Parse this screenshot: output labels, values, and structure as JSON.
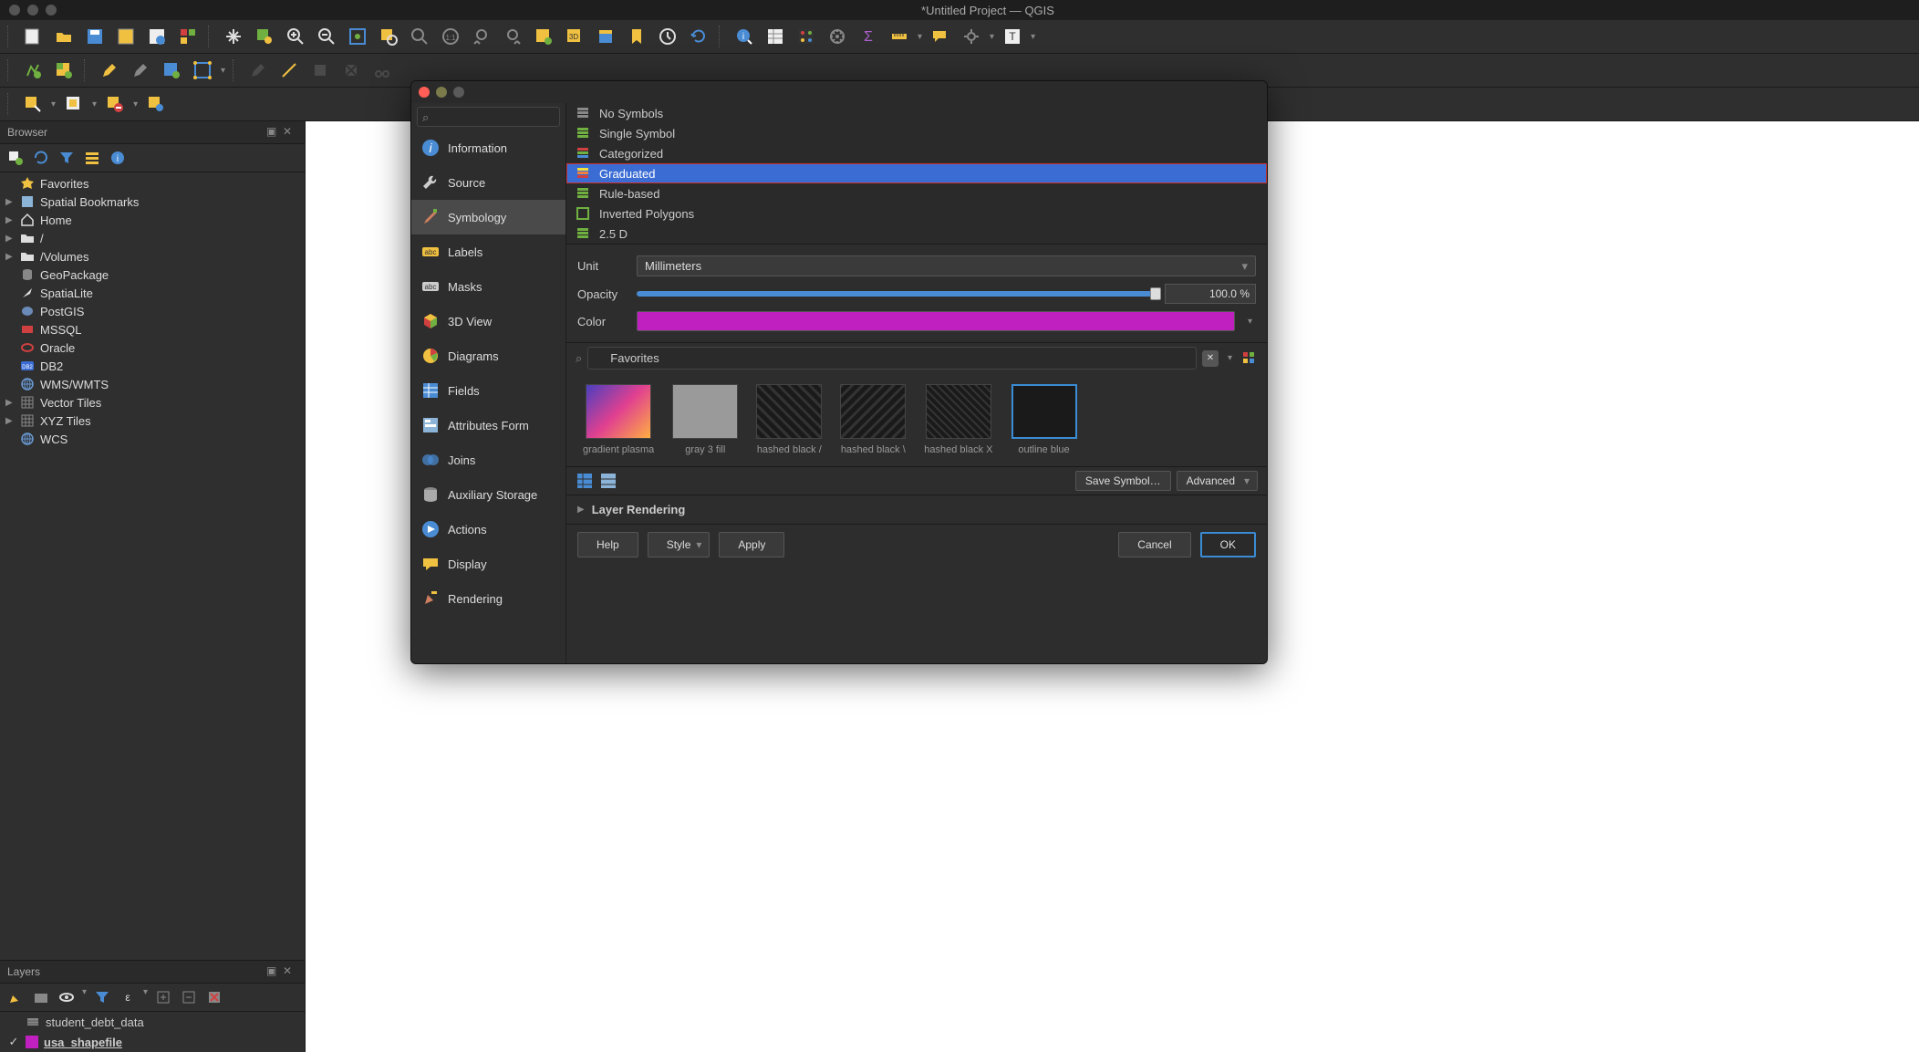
{
  "window": {
    "title": "*Untitled Project — QGIS"
  },
  "browser": {
    "title": "Browser",
    "items": [
      {
        "label": "Favorites",
        "icon": "star",
        "color": "#f0c040",
        "arrow": false
      },
      {
        "label": "Spatial Bookmarks",
        "icon": "bookmark",
        "color": "#8cb4d8",
        "arrow": true
      },
      {
        "label": "Home",
        "icon": "home",
        "color": "#ddd",
        "arrow": true
      },
      {
        "label": "/",
        "icon": "folder",
        "color": "#ddd",
        "arrow": true
      },
      {
        "label": "/Volumes",
        "icon": "folder",
        "color": "#ddd",
        "arrow": true
      },
      {
        "label": "GeoPackage",
        "icon": "db",
        "color": "#888",
        "arrow": false
      },
      {
        "label": "SpatiaLite",
        "icon": "feather",
        "color": "#ddd",
        "arrow": false
      },
      {
        "label": "PostGIS",
        "icon": "elephant",
        "color": "#6a8ab8",
        "arrow": false
      },
      {
        "label": "MSSQL",
        "icon": "mssql",
        "color": "#d04040",
        "arrow": false
      },
      {
        "label": "Oracle",
        "icon": "oracle",
        "color": "#d04040",
        "arrow": false
      },
      {
        "label": "DB2",
        "icon": "db2",
        "color": "#3a6cd4",
        "arrow": false
      },
      {
        "label": "WMS/WMTS",
        "icon": "globe",
        "color": "#6a9ad4",
        "arrow": false
      },
      {
        "label": "Vector Tiles",
        "icon": "grid",
        "color": "#888",
        "arrow": true
      },
      {
        "label": "XYZ Tiles",
        "icon": "grid",
        "color": "#888",
        "arrow": true
      },
      {
        "label": "WCS",
        "icon": "globe",
        "color": "#6a9ad4",
        "arrow": false
      }
    ]
  },
  "layers": {
    "title": "Layers",
    "items": [
      {
        "name": "student_debt_data",
        "checked": false,
        "swatch": "#888",
        "bold": false
      },
      {
        "name": "usa_shapefile",
        "checked": true,
        "swatch": "#c020c0",
        "bold": true
      }
    ]
  },
  "dialog": {
    "nav": [
      {
        "label": "Information",
        "icon": "info"
      },
      {
        "label": "Source",
        "icon": "wrench"
      },
      {
        "label": "Symbology",
        "icon": "brush",
        "active": true
      },
      {
        "label": "Labels",
        "icon": "abc"
      },
      {
        "label": "Masks",
        "icon": "abc-mask"
      },
      {
        "label": "3D View",
        "icon": "cube"
      },
      {
        "label": "Diagrams",
        "icon": "pie"
      },
      {
        "label": "Fields",
        "icon": "fields"
      },
      {
        "label": "Attributes Form",
        "icon": "form"
      },
      {
        "label": "Joins",
        "icon": "join"
      },
      {
        "label": "Auxiliary\nStorage",
        "icon": "storage"
      },
      {
        "label": "Actions",
        "icon": "play"
      },
      {
        "label": "Display",
        "icon": "speech"
      },
      {
        "label": "Rendering",
        "icon": "render"
      }
    ],
    "renderers": [
      {
        "label": "No Symbols"
      },
      {
        "label": "Single Symbol"
      },
      {
        "label": "Categorized"
      },
      {
        "label": "Graduated",
        "selected": true
      },
      {
        "label": "Rule-based"
      },
      {
        "label": "Inverted Polygons"
      },
      {
        "label": "2.5 D"
      }
    ],
    "unit_label": "Unit",
    "unit_value": "Millimeters",
    "opacity_label": "Opacity",
    "opacity_value": "100.0 %",
    "color_label": "Color",
    "color_value": "#c020c0",
    "symbol_search_value": "Favorites",
    "symbols": [
      {
        "name": "gradient plasma",
        "style": "sym-gradient"
      },
      {
        "name": "gray 3 fill",
        "style": "sym-gray"
      },
      {
        "name": "hashed black /",
        "style": "sym-hash1"
      },
      {
        "name": "hashed black \\",
        "style": "sym-hash2"
      },
      {
        "name": "hashed black X",
        "style": "sym-hash3"
      },
      {
        "name": "outline blue",
        "style": "sym-outline"
      }
    ],
    "save_symbol": "Save Symbol…",
    "advanced": "Advanced",
    "layer_rendering": "Layer Rendering",
    "help": "Help",
    "style": "Style",
    "apply": "Apply",
    "cancel": "Cancel",
    "ok": "OK"
  }
}
